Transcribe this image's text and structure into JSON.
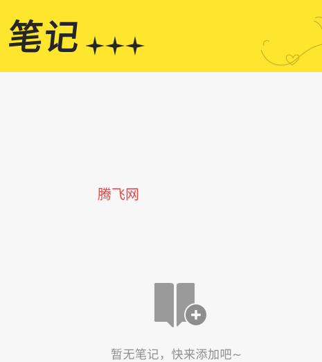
{
  "header": {
    "title": "笔记",
    "background_color": "#ffe62e",
    "sparkle_icon": "sparkle-icon",
    "doodle_icon": "vine-doodle-icon"
  },
  "watermark": {
    "text": "腾飞网",
    "color": "#e34848"
  },
  "empty_state": {
    "icon": "add-notebook-icon",
    "message": "暂无笔记，快来添加吧~",
    "icon_color": "#9a9a9a"
  }
}
